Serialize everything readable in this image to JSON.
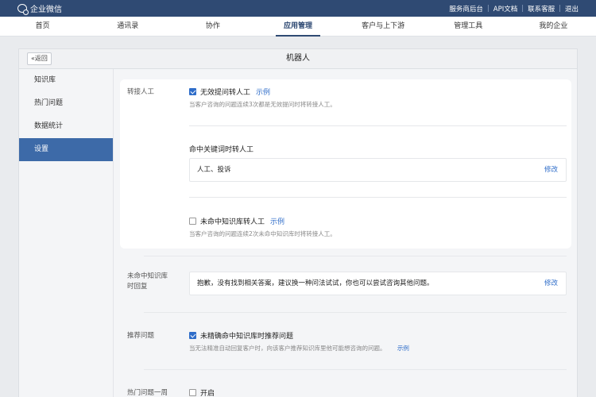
{
  "app": {
    "name": "企业微信"
  },
  "toplinks": [
    "服务商后台",
    "API文档",
    "联系客服",
    "退出"
  ],
  "nav": {
    "items": [
      "首页",
      "通讯录",
      "协作",
      "应用管理",
      "客户与上下游",
      "管理工具",
      "我的企业"
    ],
    "active_index": 3
  },
  "panel": {
    "back_label": "«返回",
    "title": "机器人"
  },
  "sidebar": {
    "items": [
      "知识库",
      "热门问题",
      "数据统计",
      "设置"
    ],
    "active_index": 3
  },
  "transfer": {
    "label": "转接人工",
    "opt1": {
      "text": "无效提问转人工",
      "link": "示例",
      "checked": true,
      "hint": "当客户咨询的问题连续3次都是无效提问时将转接人工。"
    },
    "keyword": {
      "title": "命中关键词时转人工",
      "value": "人工、投诉",
      "edit": "修改"
    },
    "opt2": {
      "text": "未命中知识库转人工",
      "link": "示例",
      "checked": false,
      "hint": "当客户咨询的问题连续2次未命中知识库时将转接人工。"
    }
  },
  "miss_reply": {
    "label_line1": "未命中知识库",
    "label_line2": "时回复",
    "value": "抱歉，没有找到相关答案，建议换一种问法试试，你也可以尝试咨询其他问题。",
    "edit": "修改"
  },
  "recommend": {
    "label": "推荐问题",
    "opt": {
      "text": "未精确命中知识库时推荐问题",
      "checked": true
    },
    "hint": "当无法精准自动回复客户时，向该客户推荐知识库里他可能想咨询的问题。",
    "link": "示例"
  },
  "hot_week": {
    "label": "热门问题一周",
    "opt": {
      "text": "开启",
      "checked": false
    }
  }
}
